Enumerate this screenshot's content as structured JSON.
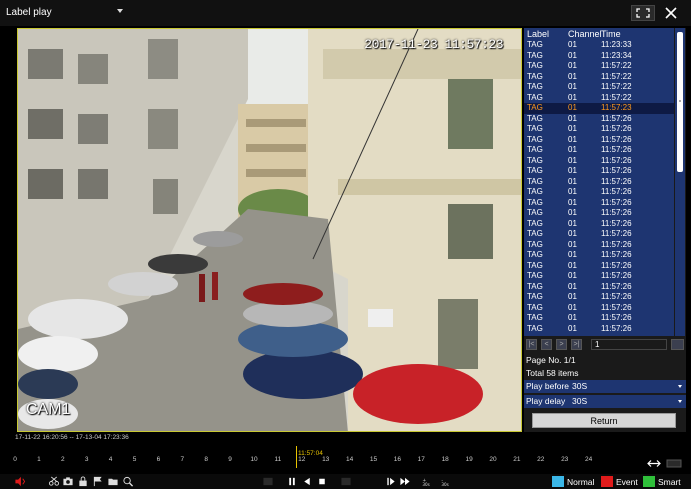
{
  "window": {
    "title": "Label play"
  },
  "video": {
    "timestamp": "2017-11-23 11:57:23",
    "camera_label": "CAM1"
  },
  "label_table": {
    "headers": [
      "Label",
      "Channel",
      "Time"
    ],
    "rows": [
      [
        "TAG",
        "01",
        "11:23:33"
      ],
      [
        "TAG",
        "01",
        "11:23:34"
      ],
      [
        "TAG",
        "01",
        "11:57:22"
      ],
      [
        "TAG",
        "01",
        "11:57:22"
      ],
      [
        "TAG",
        "01",
        "11:57:22"
      ],
      [
        "TAG",
        "01",
        "11:57:22"
      ],
      [
        "TAG",
        "01",
        "11:57:23"
      ],
      [
        "TAG",
        "01",
        "11:57:26"
      ],
      [
        "TAG",
        "01",
        "11:57:26"
      ],
      [
        "TAG",
        "01",
        "11:57:26"
      ],
      [
        "TAG",
        "01",
        "11:57:26"
      ],
      [
        "TAG",
        "01",
        "11:57:26"
      ],
      [
        "TAG",
        "01",
        "11:57:26"
      ],
      [
        "TAG",
        "01",
        "11:57:26"
      ],
      [
        "TAG",
        "01",
        "11:57:26"
      ],
      [
        "TAG",
        "01",
        "11:57:26"
      ],
      [
        "TAG",
        "01",
        "11:57:26"
      ],
      [
        "TAG",
        "01",
        "11:57:26"
      ],
      [
        "TAG",
        "01",
        "11:57:26"
      ],
      [
        "TAG",
        "01",
        "11:57:26"
      ],
      [
        "TAG",
        "01",
        "11:57:26"
      ],
      [
        "TAG",
        "01",
        "11:57:26"
      ],
      [
        "TAG",
        "01",
        "11:57:26"
      ],
      [
        "TAG",
        "01",
        "11:57:26"
      ],
      [
        "TAG",
        "01",
        "11:57:26"
      ],
      [
        "TAG",
        "01",
        "11:57:26"
      ],
      [
        "TAG",
        "01",
        "11:57:26"
      ],
      [
        "TAG",
        "01",
        "11:57:26"
      ]
    ],
    "selected_index": 6
  },
  "pager": {
    "page_input": "1",
    "page_no": "Page No. 1/1",
    "total": "Total 58 items"
  },
  "play_before": {
    "label": "Play before",
    "value": "30S"
  },
  "play_delay": {
    "label": "Play delay",
    "value": "30S"
  },
  "return_label": "Return",
  "timeline": {
    "range": "17-11-22 16:20:56 -- 17-13-04 17:23:36",
    "cursor_time": "11:57:04",
    "hours": [
      "0",
      "1",
      "2",
      "3",
      "4",
      "5",
      "6",
      "7",
      "8",
      "9",
      "10",
      "11",
      "12",
      "13",
      "14",
      "15",
      "16",
      "17",
      "18",
      "19",
      "20",
      "21",
      "22",
      "23",
      "24"
    ]
  },
  "legend": [
    {
      "label": "Normal",
      "color": "#3bb7e8"
    },
    {
      "label": "Event",
      "color": "#e01b1b"
    },
    {
      "label": "Smart",
      "color": "#2fbf3a"
    }
  ],
  "toolbar_icons": [
    "audio-icon",
    "scissors-icon",
    "camera-icon",
    "lock-icon",
    "flag-icon",
    "folder-icon",
    "zoom-icon",
    "prev-frame-icon",
    "pause-icon",
    "reverse-play-icon",
    "stop-icon",
    "slow-icon",
    "forward-frame-icon",
    "fast-forward-icon",
    "speed-30s-icon",
    "speed-30s-alt-icon"
  ]
}
